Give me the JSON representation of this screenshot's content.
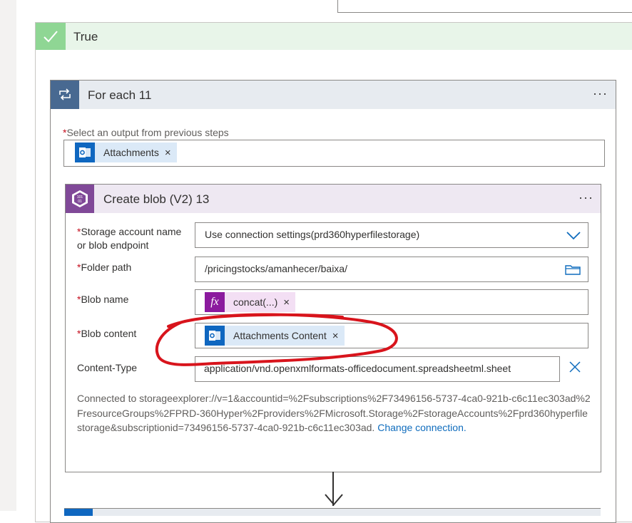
{
  "true_branch": {
    "label": "True"
  },
  "foreach": {
    "title": "For each 11",
    "more_label": "···",
    "select_label": "Select an output from previous steps",
    "token": {
      "label": "Attachments",
      "remove": "×",
      "icon": "outlook-icon"
    }
  },
  "create_blob": {
    "title": "Create blob (V2) 13",
    "more_label": "···",
    "fields": {
      "storage": {
        "label_line1": "Storage account name",
        "label_line2": "or blob endpoint",
        "value": "Use connection settings(prd360hyperfilestorage)"
      },
      "folder": {
        "label": "Folder path",
        "value": "/pricingstocks/amanhecer/baixa/"
      },
      "blob_name": {
        "label": "Blob name",
        "token_label": "concat(...)",
        "token_icon_text": "fx",
        "remove": "×"
      },
      "blob_content": {
        "label": "Blob content",
        "token_label": "Attachments Content",
        "remove": "×"
      },
      "content_type": {
        "label": "Content-Type",
        "value": "application/vnd.openxmlformats-officedocument.spreadsheetml.sheet"
      }
    },
    "connection": {
      "text": "Connected to storageexplorer://v=1&accountid=%2Fsubscriptions%2F73496156-5737-4ca0-921b-c6c11ec303ad%2FresourceGroups%2FPRD-360Hyper%2Fproviders%2FMicrosoft.Storage%2FstorageAccounts%2Fprd360hyperfilestorage&subscriptionid=73496156-5737-4ca0-921b-c6c11ec303ad.",
      "link": "Change connection."
    }
  },
  "colors": {
    "annotation_circle": "#d8141c",
    "true_accent": "#8fd694",
    "foreach_accent": "#486991",
    "blob_accent": "#804998",
    "outlook_blue": "#0f67c0"
  }
}
